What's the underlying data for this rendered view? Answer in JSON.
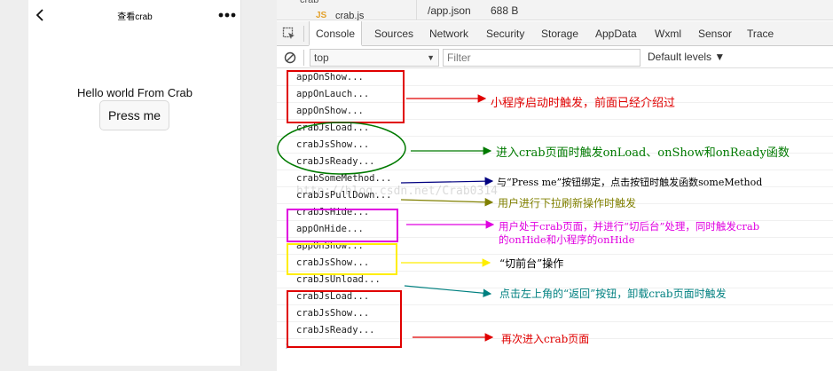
{
  "colors": {
    "red": "#e00000",
    "green": "#007a00",
    "navy": "#000080",
    "olive": "#808000",
    "magenta": "#e000e0",
    "yellow": "#ffee00",
    "teal": "#008080"
  },
  "simulator": {
    "title": "查看crab",
    "back_icon": "chevron-left-icon",
    "more_icon": "more-dots-icon",
    "hello_text": "Hello world From Crab",
    "button_label": "Press me"
  },
  "file_strip": {
    "tree_line": "crab",
    "tree_icon": "JS",
    "tree_file": "crab.js",
    "info_path": "/app.json",
    "info_size": "688 B"
  },
  "devtools": {
    "inspect_icon": "inspect-element-icon",
    "tabs": [
      "Console",
      "Sources",
      "Network",
      "Security",
      "Storage",
      "AppData",
      "Wxml",
      "Sensor",
      "Trace"
    ],
    "active_tab": "Console",
    "clear_icon": "clear-console-icon",
    "context": "top",
    "filter_placeholder": "Filter",
    "levels": "Default levels ▼",
    "prompt": "›"
  },
  "console_lines": [
    "appOnShow...",
    "appOnLauch...",
    "appOnShow...",
    "crabJsLoad...",
    "crabJsShow...",
    "crabJsReady...",
    "crabSomeMethod...",
    "crabJsPullDown...",
    "crabJsHide...",
    "appOnHide...",
    "appOnShow...",
    "crabJsShow...",
    "crabJsUnload...",
    "crabJsLoad...",
    "crabJsShow...",
    "crabJsReady..."
  ],
  "annotations": {
    "a1": "小程序启动时触发，前面已经介绍过",
    "a2": "进入crab页面时触发onLoad、onShow和onReady函数",
    "a3": "与“Press me”按钮绑定，点击按钮时触发函数someMethod",
    "a4": "用户进行下拉刷新操作时触发",
    "a5_line1": "用户处于crab页面，并进行“切后台”处理，同时触发crab",
    "a5_line2": "的onHide和小程序的onHide",
    "a6": "“切前台”操作",
    "a7": "点击左上角的“返回”按钮，卸载crab页面时触发",
    "a8": "再次进入crab页面"
  },
  "watermark": "http://blog.csdn.net/Crab0314"
}
